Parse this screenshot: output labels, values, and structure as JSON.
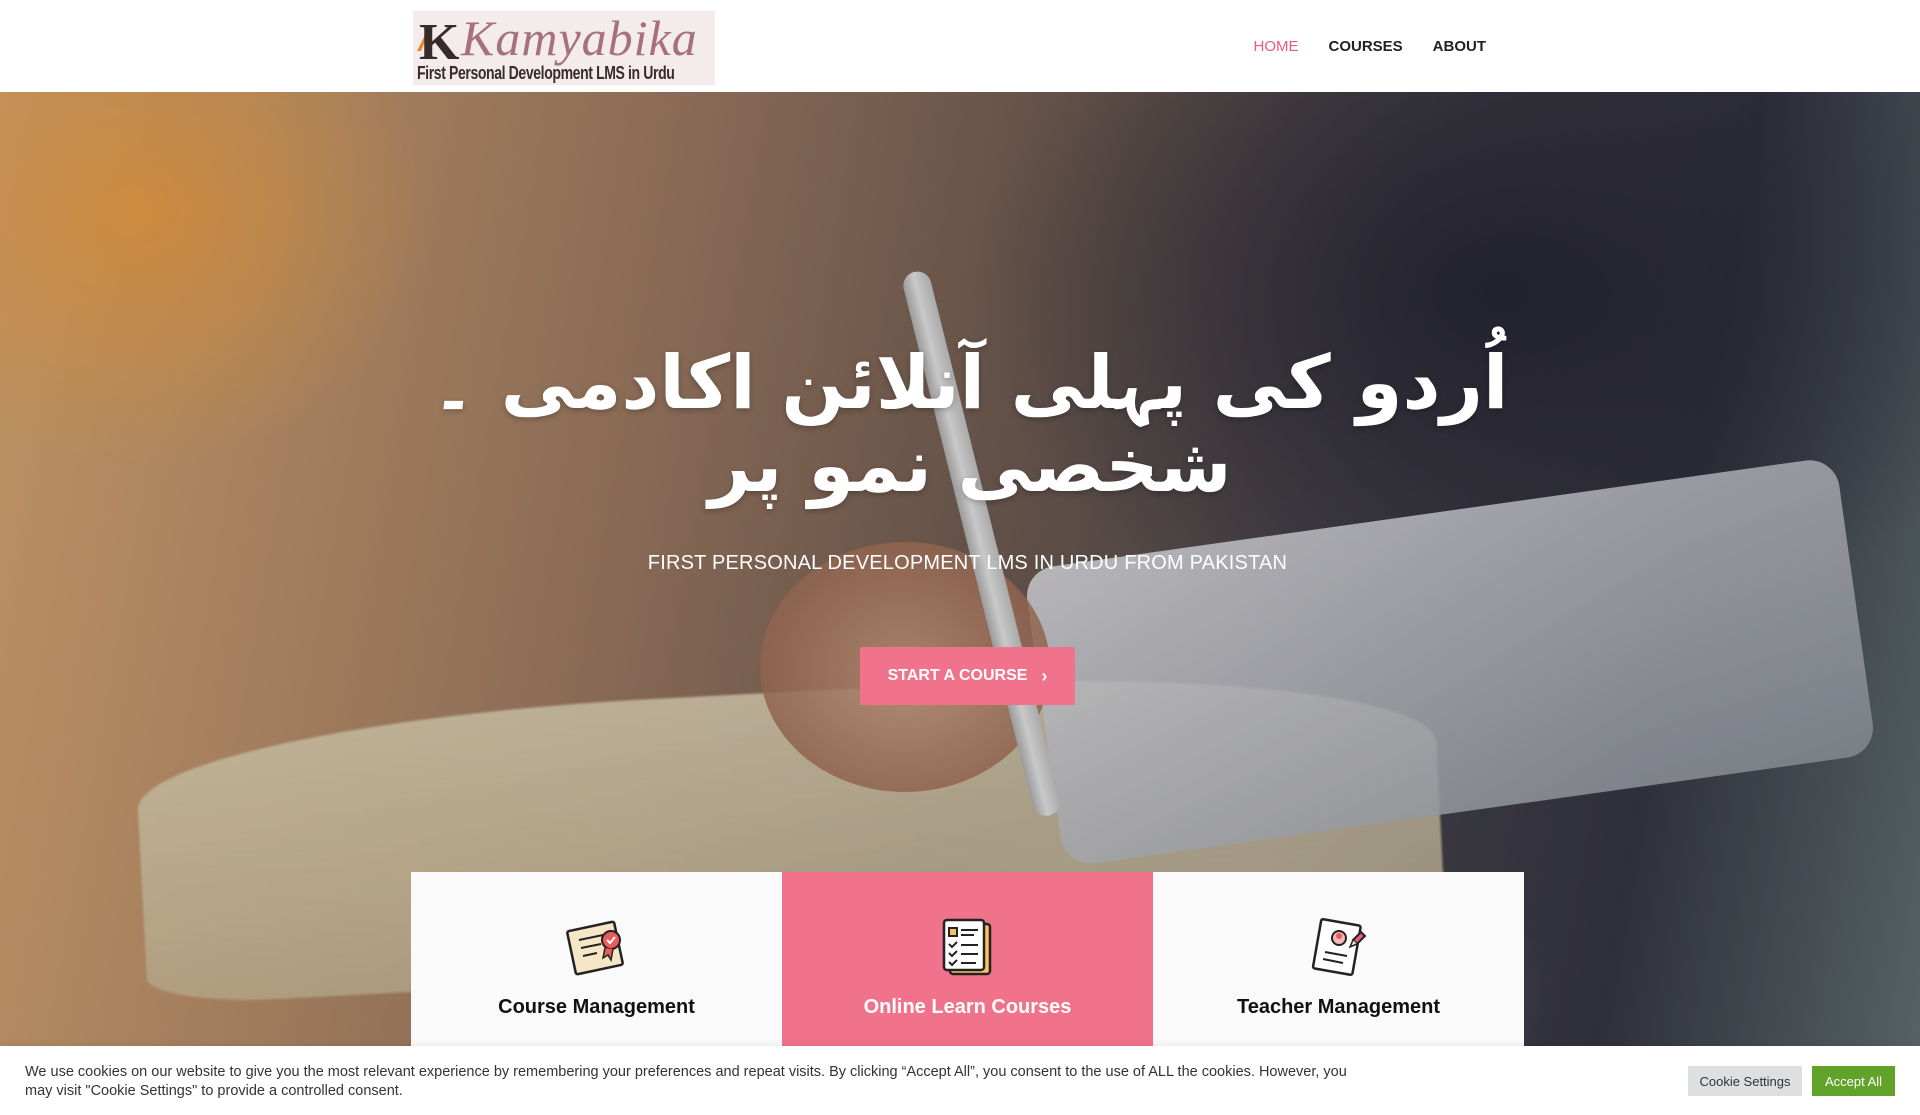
{
  "header": {
    "logo": {
      "letter": "K",
      "wordmark": "Kamyabika",
      "tagline": "First Personal Development LMS in Urdu"
    },
    "nav": [
      {
        "label": "HOME",
        "active": true
      },
      {
        "label": "COURSES",
        "active": false
      },
      {
        "label": "ABOUT",
        "active": false
      }
    ]
  },
  "hero": {
    "title": "اُردو کی پہلی آنلائن اکادمی ۔ شخصی نمو پر",
    "subtitle": "FIRST PERSONAL DEVELOPMENT LMS IN URDU FROM PAKISTAN",
    "cta_label": "START A COURSE",
    "cta_icon": "chevron-right-icon"
  },
  "features": [
    {
      "title": "Course Management",
      "icon": "certificate-icon",
      "highlighted": false
    },
    {
      "title": "Online Learn Courses",
      "icon": "checklist-document-icon",
      "highlighted": true
    },
    {
      "title": "Teacher Management",
      "icon": "teacher-profile-icon",
      "highlighted": false
    }
  ],
  "cookie_bar": {
    "text": "We use cookies on our website to give you the most relevant experience by remembering your preferences and repeat visits. By clicking “Accept All”, you consent to the use of ALL the cookies. However, you may visit \"Cookie Settings\" to provide a controlled consent.",
    "settings_label": "Cookie Settings",
    "accept_label": "Accept All"
  },
  "colors": {
    "accent_pink": "#f0728b",
    "nav_active": "#e85c7d",
    "accept_green": "#61a229"
  }
}
